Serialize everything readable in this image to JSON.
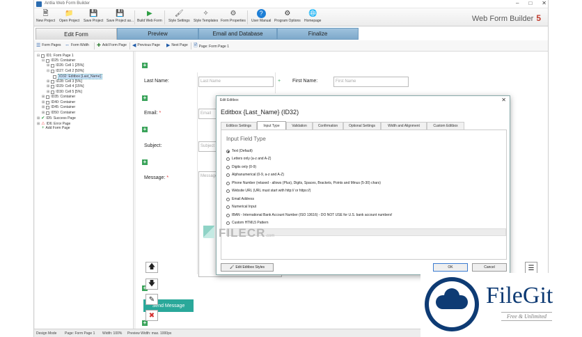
{
  "window": {
    "title": "Antlia Web Form Builder",
    "brand_name": "Web Form Builder",
    "brand_version": "5"
  },
  "ribbon": {
    "buttons": [
      {
        "label": "New Project",
        "icon": "new-file-icon"
      },
      {
        "label": "Open Project",
        "icon": "open-folder-icon"
      },
      {
        "label": "Save Project",
        "icon": "save-icon"
      },
      {
        "label": "Save Project as...",
        "icon": "save-as-icon"
      },
      {
        "label": "Build Web Form",
        "icon": "play-icon"
      },
      {
        "label": "Style Settings",
        "icon": "style-icon"
      },
      {
        "label": "Style Templates",
        "icon": "templates-icon"
      },
      {
        "label": "Form Properties",
        "icon": "properties-icon"
      },
      {
        "label": "User Manual",
        "icon": "help-icon"
      },
      {
        "label": "Program Options",
        "icon": "gear-icon"
      },
      {
        "label": "Homepage",
        "icon": "globe-icon"
      }
    ]
  },
  "tabs": [
    "Edit Form",
    "Preview",
    "Email and Database",
    "Finalize"
  ],
  "toolbar2": {
    "form_pages": "Form Pages",
    "form_width": "Form Width",
    "add_form_page": "Add Form Page",
    "previous_page": "Previous Page",
    "next_page": "Next Page",
    "page_label": "Page: Form Page 1"
  },
  "tree": [
    "ID1: Form Page 1",
    "ID25: Container",
    "ID26: Cell 1 [25%]",
    "ID27: Cell 2 [50%]",
    "ID32: Editbox [Last_Name]",
    "ID28: Cell 3 [5%]",
    "ID29: Cell 4 [15%]",
    "ID30: Cell 5 [5%]",
    "ID35: Container",
    "ID40: Container",
    "ID45: Container",
    "ID50: Container",
    "ID5: Success Page",
    "ID6: Error Page",
    "Add Form Page"
  ],
  "form": {
    "last_name_label": "Last Name:",
    "last_name_placeholder": "Last Name",
    "first_name_label": "First Name:",
    "first_name_placeholder": "First Name",
    "email_label": "Email:",
    "email_placeholder": "Email",
    "subject_label": "Subject:",
    "subject_placeholder": "Subject",
    "message_label": "Message:",
    "message_placeholder": "Message",
    "required_mark": "*",
    "send_button": "Send Message"
  },
  "dialog": {
    "window_title": "Edit Editbox",
    "heading": "Editbox {Last_Name} (ID32)",
    "tabs": [
      "Editbox Settings",
      "Input Type",
      "Validation",
      "Confirmation",
      "Optional Settings",
      "Width and Alignment",
      "Custom Editbox"
    ],
    "active_tab": "Input Type",
    "section": "Input Field Type",
    "options": [
      "Text (Default)",
      "Letters only (a-z and A-Z)",
      "Digits only (0-9)",
      "Alphanumerical (0-9, a-z and A-Z)",
      "Phone Number (relaxed - allows (Plus), Digits, Spaces, Brackets, Points and Minus (5-30) chars)",
      "Website URL (URL must start with http:// or https://)",
      "Email Address",
      "Numerical Input",
      "IBAN - International Bank Account Number (ISO 13616) - DO NOT USE for U.S. bank account numbers!",
      "Custom HTML5 Pattern"
    ],
    "selected_index": 0,
    "edit_styles_button": "Edit Editbox Styles",
    "ok_button": "OK",
    "cancel_button": "Cancel"
  },
  "watermark": {
    "text": "FILECR",
    "suffix": ".com"
  },
  "statusbar": {
    "mode": "Design Mode",
    "page": "Page: Form Page 1",
    "width": "Width: 100%",
    "preview": "Preview Width: max. 1000px"
  },
  "logo": {
    "name": "FileGit",
    "tagline": "Free & Unlimited"
  },
  "colors": {
    "accent_green": "#3aa35a",
    "send_button": "#2aa89a",
    "tab_blue": "#7ea9cb",
    "logo_blue": "#0e3b74"
  }
}
